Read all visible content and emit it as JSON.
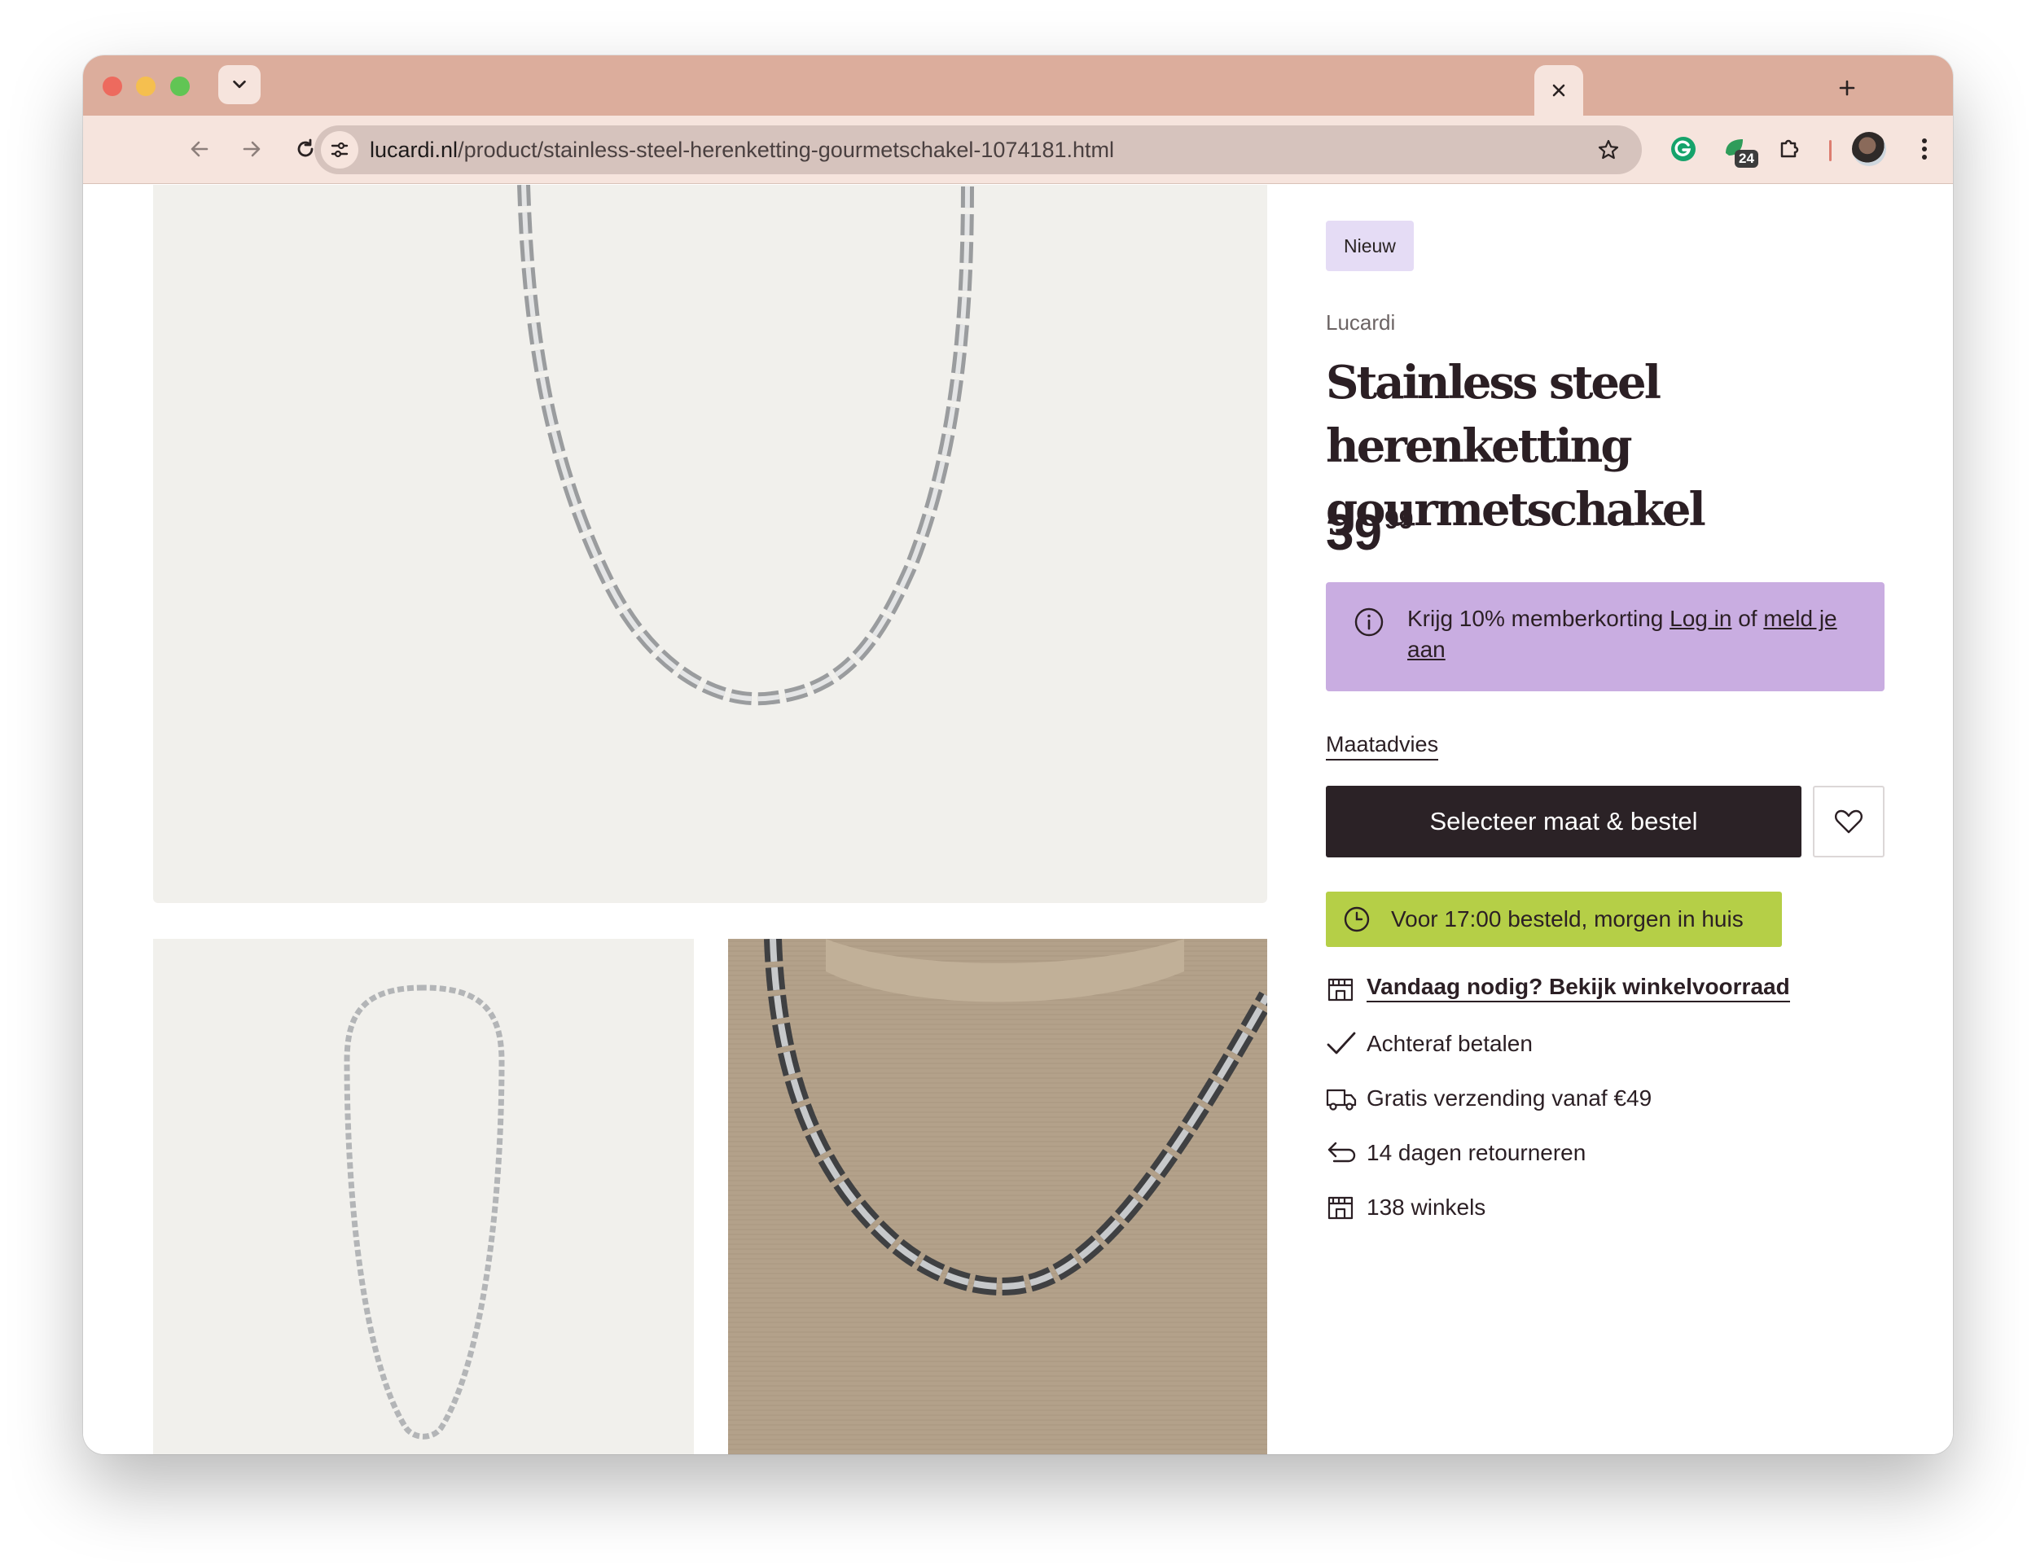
{
  "browser": {
    "url_host": "lucardi.nl",
    "url_path": "/product/stainless-steel-herenketting-gourmetschakel-1074181.html",
    "extension_badge": "24"
  },
  "product": {
    "badge": "Nieuw",
    "brand": "Lucardi",
    "title": "Stainless steel herenketting gourmetschakel",
    "price_whole": "39",
    "price_cents": "99"
  },
  "member": {
    "text": "Krijg 10% memberkorting",
    "login_link": "Log in",
    "or_text": "of",
    "signup_link": "meld je aan"
  },
  "size_advice": "Maatadvies",
  "cta_label": "Selecteer maat & bestel",
  "delivery": "Voor 17:00 besteld, morgen in huis",
  "usps": [
    {
      "icon": "store-icon",
      "label": "Vandaag nodig? Bekijk winkelvoorraad"
    },
    {
      "icon": "check-icon",
      "label": "Achteraf betalen"
    },
    {
      "icon": "truck-icon",
      "label": "Gratis verzending vanaf €49"
    },
    {
      "icon": "return-icon",
      "label": "14 dagen retourneren"
    },
    {
      "icon": "store-icon",
      "label": "138 winkels"
    }
  ],
  "colors": {
    "tabbar": "#dcad9c",
    "toolbar": "#f6e4dd",
    "member_bg": "#c9ade1",
    "delivery_bg": "#b5cf47",
    "cta_bg": "#2b2226",
    "badge_bg": "#e5dcf5"
  }
}
